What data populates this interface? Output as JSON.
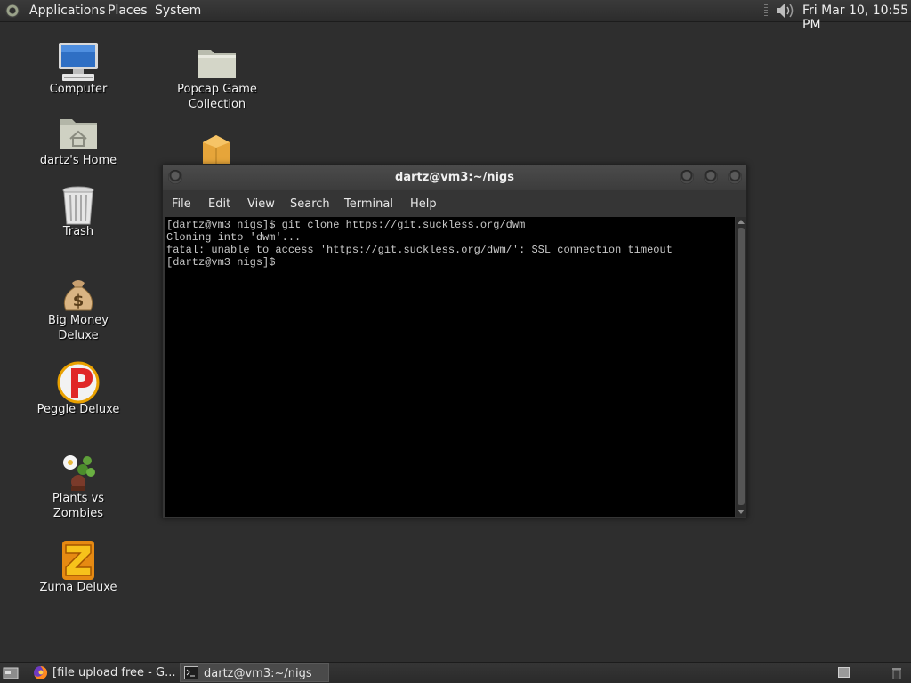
{
  "top_panel": {
    "menus": [
      "Applications",
      "Places",
      "System"
    ],
    "clock": "Fri Mar 10, 10:55 PM"
  },
  "desktop": {
    "icons": [
      {
        "label": "Computer",
        "icon": "computer-icon"
      },
      {
        "label": "Popcap Game Collection",
        "icon": "folder-icon"
      },
      {
        "label": "dartz's Home",
        "icon": "home-folder-icon"
      },
      {
        "label": "Trash",
        "icon": "trash-icon"
      },
      {
        "label": "Big Money Deluxe",
        "icon": "money-bag-icon"
      },
      {
        "label": "Peggle Deluxe",
        "icon": "peggle-icon"
      },
      {
        "label": "Plants vs Zombies",
        "icon": "plants-vs-zombies-icon"
      },
      {
        "label": "Zuma Deluxe",
        "icon": "zuma-icon"
      }
    ]
  },
  "terminal": {
    "title": "dartz@vm3:~/nigs",
    "menu": [
      "File",
      "Edit",
      "View",
      "Search",
      "Terminal",
      "Help"
    ],
    "lines": [
      "[dartz@vm3 nigs]$ git clone https://git.suckless.org/dwm",
      "Cloning into 'dwm'...",
      "fatal: unable to access 'https://git.suckless.org/dwm/': SSL connection timeout",
      "[dartz@vm3 nigs]$ "
    ]
  },
  "taskbar": {
    "tasks": [
      {
        "label": "[file upload free - G...",
        "icon": "firefox-icon",
        "active": false
      },
      {
        "label": "dartz@vm3:~/nigs",
        "icon": "terminal-icon",
        "active": true
      }
    ]
  },
  "colors": {
    "desktop_bg": "#2e2e2e",
    "terminal_bg": "#000000",
    "terminal_fg": "#c8c8c8"
  }
}
